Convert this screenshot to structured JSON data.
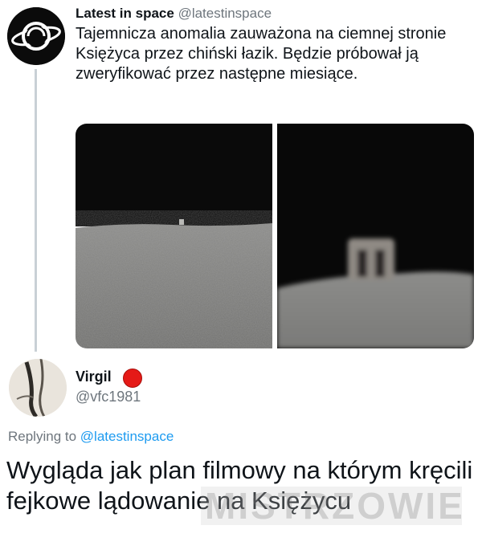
{
  "original_tweet": {
    "author_name": "Latest in space",
    "author_handle": "@latestinspace",
    "text": "Tajemnicza anomalia zauważona na ciemnej stronie Księżyca przez chiński łazik. Będzie próbował ją zweryfikować przez następne miesiące.",
    "media_icon": "lunar-surface-photo-pair"
  },
  "reply_tweet": {
    "author_name": "Virgil",
    "author_handle": "@vfc1981",
    "replying_prefix": "Replying to",
    "replying_mention": "@latestinspace",
    "text": "Wygląda jak plan filmowy na którym kręcili fejkowe lądowanie na Księżycu",
    "badge_color": "#e51a17"
  },
  "watermark": "MISTRZOWIE",
  "colors": {
    "link": "#1d9bf0",
    "muted": "#6e767d",
    "text": "#0f1419"
  }
}
